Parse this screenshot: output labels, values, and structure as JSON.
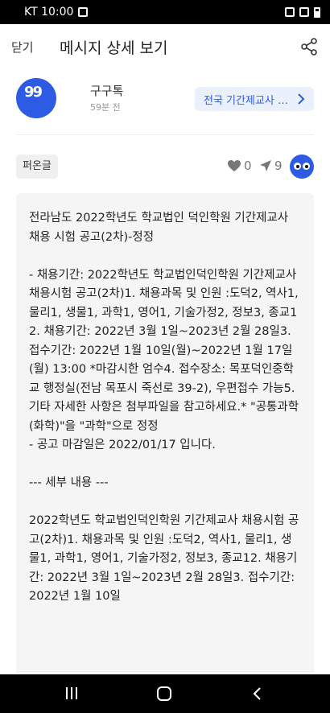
{
  "status_bar": {
    "carrier_time": "KT 10:00"
  },
  "appbar": {
    "close_label": "닫기",
    "title": "메시지 상세 보기"
  },
  "sender": {
    "name": "구구톡",
    "time": "59분 전",
    "avatar_text": "99",
    "category": "전국 기간제교사 채용정보"
  },
  "meta": {
    "tag": "퍼온글",
    "likes": "0",
    "shares": "9"
  },
  "message": {
    "body": "전라남도 2022학년도 학교법인 덕인학원 기간제교사 채용 시험 공고(2차)-정정\n\n- 채용기간: 2022학년도 학교법인덕인학원 기간제교사 채용시험 공고(2차)1. 채용과목 및 인원 :도덕2, 역사1, 물리1, 생물1, 과학1, 영어1, 기술가정2, 정보3, 종교12. 채용기간: 2022년 3월 1일~2023년 2월 28일3. 접수기간: 2022년 1월 10일(월)~2022년 1월 17일(월) 13:00 *마감시한 엄수4. 접수장소: 목포덕인중학교 행정실(전남 목포시 죽선로 39-2), 우편접수 가능5. 기타 자세한 사항은 첨부파일을 참고하세요.* \"공통과학(화학)\"을 \"과학\"으로 정정\n- 공고 마감일은 2022/01/17 입니다.\n\n--- 세부 내용 ---\n\n2022학년도 학교법인덕인학원 기간제교사 채용시험 공고(2차)1. 채용과목 및 인원 :도덕2, 역사1, 물리1, 생물1, 과학1, 영어1, 기술가정2, 정보3, 종교12. 채용기간: 2022년 3월 1일~2023년 2월 28일3. 접수기간: 2022년 1월 10일"
  },
  "colors": {
    "accent": "#2d5be3",
    "tag_bg": "#eaf1fc",
    "card_bg": "#f5f5f5"
  },
  "icons": [
    "share-icon",
    "chevron-right-icon",
    "heart-icon",
    "send-icon",
    "recents-icon",
    "home-icon",
    "back-icon"
  ]
}
